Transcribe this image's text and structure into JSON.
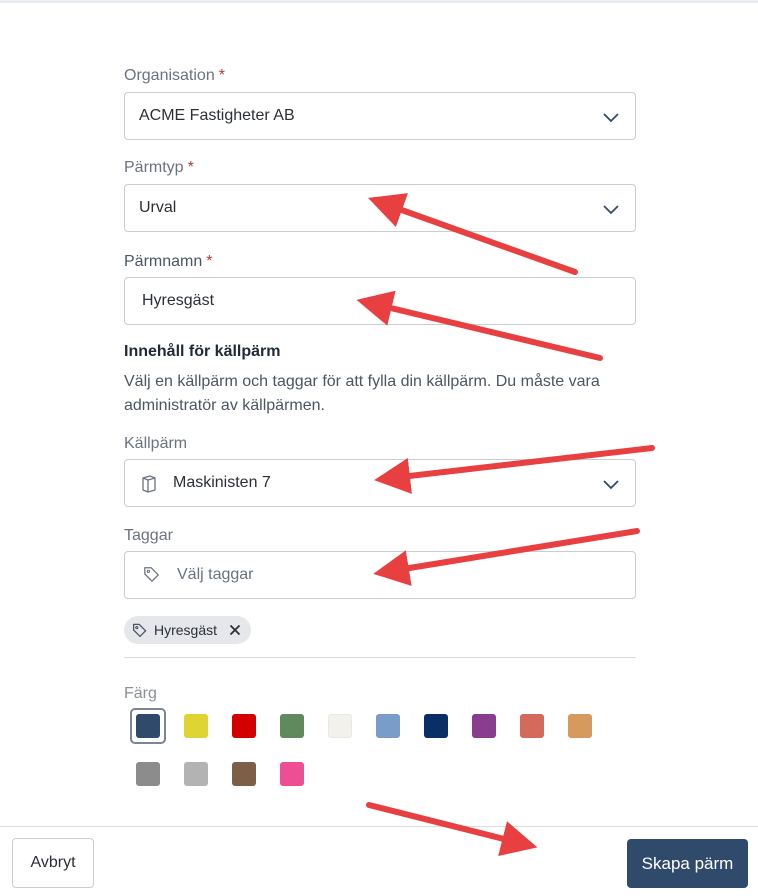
{
  "form": {
    "organisation": {
      "label": "Organisation",
      "required": "*",
      "value": "ACME Fastigheter AB"
    },
    "binder_type": {
      "label": "Pärmtyp",
      "required": "*",
      "value": "Urval"
    },
    "binder_name": {
      "label": "Pärmnamn",
      "required": "*",
      "value": "Hyresgäst"
    },
    "source_section": {
      "title": "Innehåll för källpärm",
      "description": "Välj en källpärm och taggar för att fylla din källpärm. Du måste vara administratör av källpärmen."
    },
    "source_binder": {
      "label": "Källpärm",
      "value": "Maskinisten 7",
      "icon": "binder-icon"
    },
    "tags": {
      "label": "Taggar",
      "placeholder": "Välj taggar",
      "icon": "tag-icon",
      "selected": [
        {
          "label": "Hyresgäst"
        }
      ]
    },
    "color": {
      "label": "Färg",
      "selected_index": 0,
      "options": [
        "#2f4a6b",
        "#e0d433",
        "#d40000",
        "#5f8a5e",
        "#f3f1ec",
        "#7a9cc9",
        "#0a2f66",
        "#8a3d8f",
        "#d46a5b",
        "#d69a5e",
        "#8c8c8c",
        "#b3b3b3",
        "#7d5f48",
        "#ee4f94"
      ]
    }
  },
  "footer": {
    "cancel_label": "Avbryt",
    "submit_label": "Skapa pärm"
  },
  "annotation_color": "#e84040"
}
